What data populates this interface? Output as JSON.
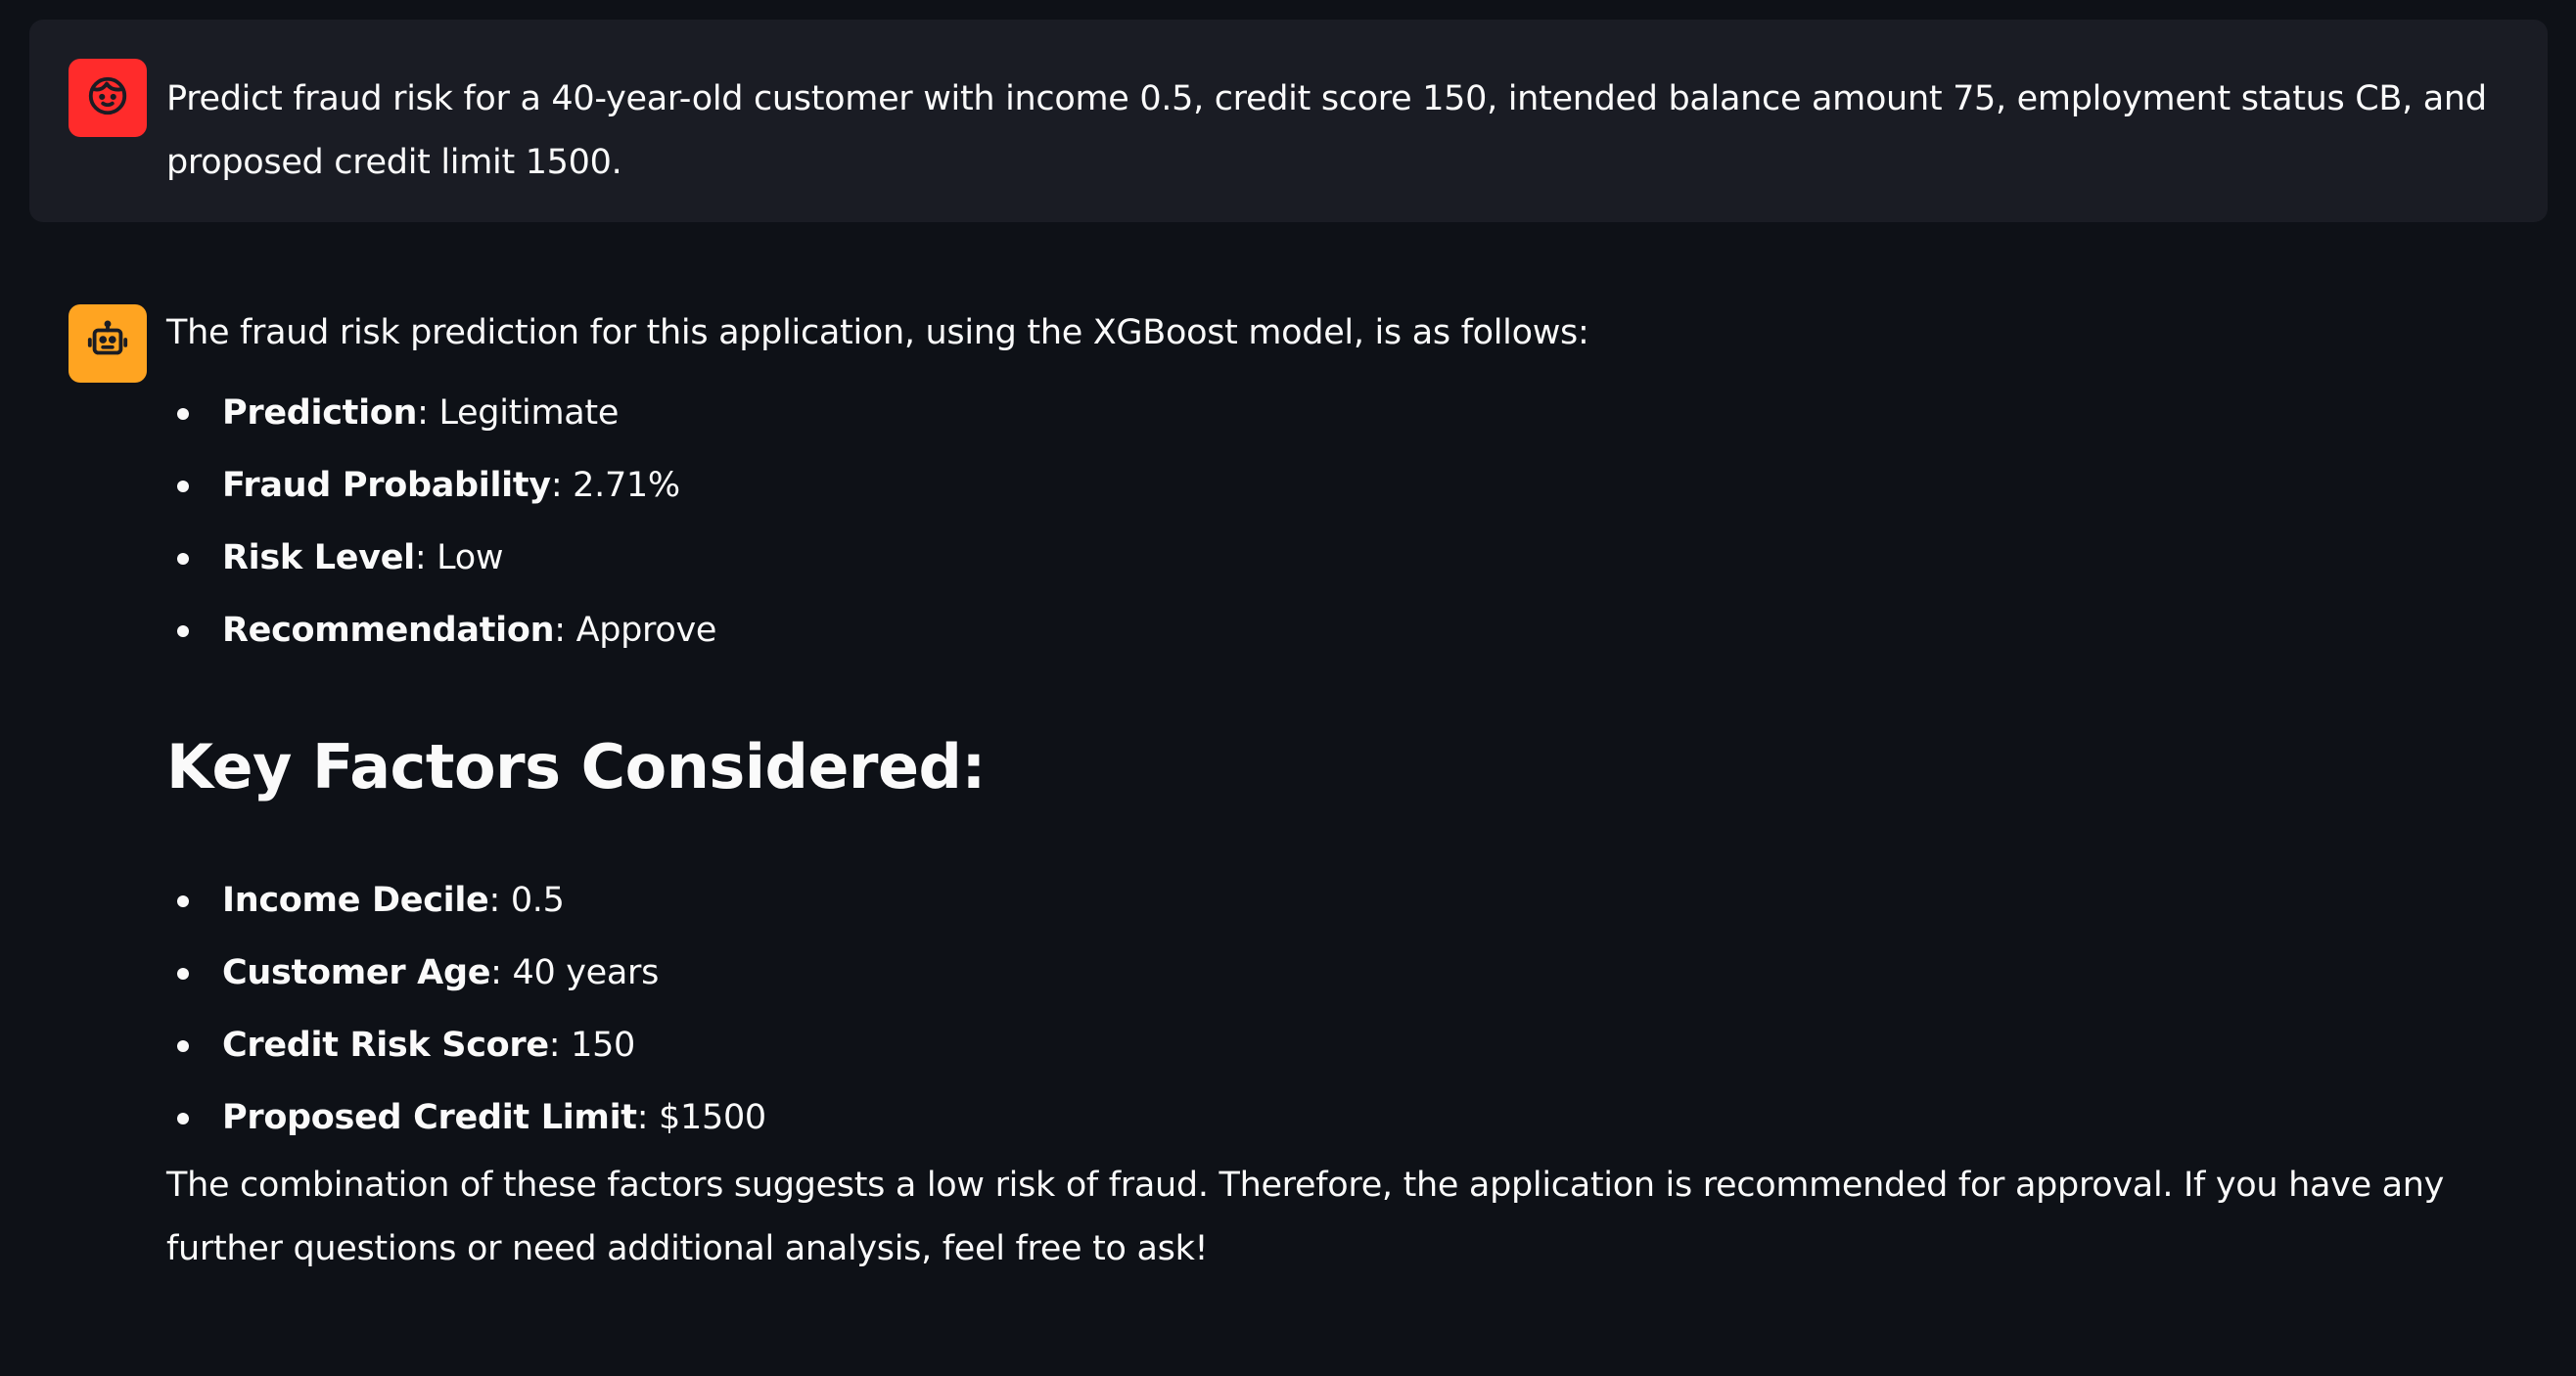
{
  "messages": {
    "user": {
      "avatar_icon": "user-face-icon",
      "avatar_color": "#ff2b2b",
      "text": "Predict fraud risk for a 40-year-old customer with income 0.5, credit score 150, intended balance amount 75, employment status CB, and proposed credit limit 1500."
    },
    "assistant": {
      "avatar_icon": "robot-icon",
      "avatar_color": "#ffa421",
      "intro": "The fraud risk prediction for this application, using the XGBoost model, is as follows:",
      "results": [
        {
          "label": "Prediction",
          "value": ": Legitimate"
        },
        {
          "label": "Fraud Probability",
          "value": ": 2.71%"
        },
        {
          "label": "Risk Level",
          "value": ": Low"
        },
        {
          "label": "Recommendation",
          "value": ": Approve"
        }
      ],
      "factors_heading": "Key Factors Considered:",
      "factors": [
        {
          "label": "Income Decile",
          "value": ": 0.5"
        },
        {
          "label": "Customer Age",
          "value": ": 40 years"
        },
        {
          "label": "Credit Risk Score",
          "value": ": 150"
        },
        {
          "label": "Proposed Credit Limit",
          "value": ": $1500"
        }
      ],
      "closing": "The combination of these factors suggests a low risk of fraud. Therefore, the application is recommended for approval. If you have any further questions or need additional analysis, feel free to ask!"
    }
  }
}
